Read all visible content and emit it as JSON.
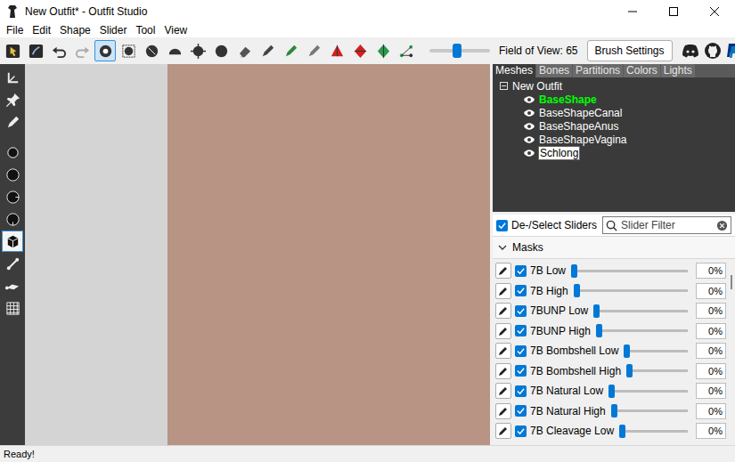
{
  "window": {
    "title": "New Outfit* - Outfit Studio"
  },
  "menu": [
    "File",
    "Edit",
    "Shape",
    "Slider",
    "Tool",
    "View"
  ],
  "toolbar": {
    "tools": [
      {
        "kind": "select",
        "selected": false
      },
      {
        "kind": "select2",
        "selected": false
      },
      {
        "kind": "undo",
        "selected": false
      },
      {
        "kind": "redo",
        "selected": false
      },
      {
        "kind": "brush",
        "selected": true
      },
      {
        "kind": "mask",
        "selected": false
      },
      {
        "kind": "inflate",
        "selected": false
      },
      {
        "kind": "deflate",
        "selected": false
      },
      {
        "kind": "move",
        "selected": false
      },
      {
        "kind": "smooth",
        "selected": false
      },
      {
        "kind": "erase",
        "selected": false
      },
      {
        "kind": "pen",
        "selected": false
      },
      {
        "kind": "color",
        "selected": false
      },
      {
        "kind": "alpha",
        "selected": false
      },
      {
        "kind": "collapse",
        "selected": false
      },
      {
        "kind": "flip",
        "selected": false
      },
      {
        "kind": "split",
        "selected": false
      },
      {
        "kind": "nodes",
        "selected": false
      }
    ],
    "field_of_view": {
      "label": "Field of View: 65",
      "level": 0.46
    },
    "button": "Brush Settings"
  },
  "left_tools": [
    {
      "kind": "axes",
      "selected": false
    },
    {
      "kind": "pin",
      "selected": false
    },
    {
      "kind": "pen",
      "selected": false
    },
    {
      "kind": "dot",
      "selected": false
    },
    {
      "kind": "ball",
      "selected": false
    },
    {
      "kind": "ball-right",
      "selected": false
    },
    {
      "kind": "ball-down",
      "selected": false
    },
    {
      "kind": "cube",
      "selected": true
    },
    {
      "kind": "bone",
      "selected": false
    },
    {
      "kind": "bone2",
      "selected": false
    },
    {
      "kind": "grid",
      "selected": false
    }
  ],
  "tabs": [
    {
      "label": "Meshes",
      "selected": true
    },
    {
      "label": "Bones",
      "selected": false
    },
    {
      "label": "Partitions",
      "selected": false
    },
    {
      "label": "Colors",
      "selected": false
    },
    {
      "label": "Lights",
      "selected": false
    }
  ],
  "tree": {
    "root": {
      "label": "New Outfit",
      "expanded": true
    },
    "items": [
      {
        "label": "BaseShape",
        "visible": true,
        "active": true,
        "selected": false
      },
      {
        "label": "BaseShapeCanal",
        "visible": true,
        "active": false,
        "selected": false
      },
      {
        "label": "BaseShapeAnus",
        "visible": true,
        "active": false,
        "selected": false
      },
      {
        "label": "BaseShapeVagina",
        "visible": true,
        "active": false,
        "selected": false
      },
      {
        "label": "Schlong",
        "visible": true,
        "active": false,
        "selected": true
      }
    ]
  },
  "select_all": {
    "label": "De-/Select Sliders",
    "checked": true
  },
  "filter": {
    "placeholder": "Slider Filter"
  },
  "group": {
    "label": "Masks",
    "expanded": true
  },
  "sliders": [
    {
      "name": "7B Low",
      "checked": true,
      "level": 0,
      "reading": "0%"
    },
    {
      "name": "7B High",
      "checked": true,
      "level": 0,
      "reading": "0%"
    },
    {
      "name": "7BUNP Low",
      "checked": true,
      "level": 0,
      "reading": "0%"
    },
    {
      "name": "7BUNP High",
      "checked": true,
      "level": 0,
      "reading": "0%"
    },
    {
      "name": "7B Bombshell Low",
      "checked": true,
      "level": 0,
      "reading": "0%"
    },
    {
      "name": "7B Bombshell High",
      "checked": true,
      "level": 0,
      "reading": "0%"
    },
    {
      "name": "7B Natural Low",
      "checked": true,
      "level": 0,
      "reading": "0%"
    },
    {
      "name": "7B Natural High",
      "checked": true,
      "level": 0,
      "reading": "0%"
    },
    {
      "name": "7B Cleavage Low",
      "checked": true,
      "level": 0,
      "reading": "0%"
    }
  ],
  "status_bar": "Ready!"
}
